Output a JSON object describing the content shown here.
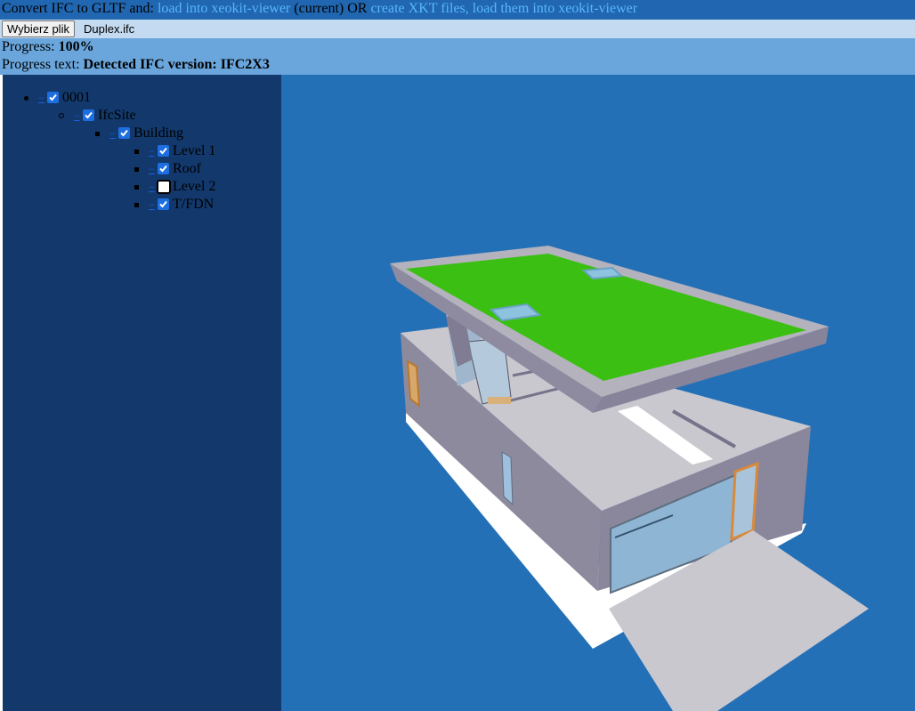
{
  "header": {
    "prefix": "Convert IFC to GLTF and:",
    "link_viewer": "load into xeokit-viewer",
    "current": "(current) OR",
    "link_xkt": "create XKT files, load them into xeokit-viewer"
  },
  "file": {
    "button_label": "Wybierz plik",
    "filename": "Duplex.ifc"
  },
  "progress": {
    "label": "Progress:",
    "value": "100%",
    "text_label": "Progress text:",
    "text_value": "Detected IFC version: IFC2X3"
  },
  "tree": [
    {
      "label": "0001",
      "checked": true,
      "depth": 0
    },
    {
      "label": "IfcSite",
      "checked": true,
      "depth": 1
    },
    {
      "label": "Building",
      "checked": true,
      "depth": 2
    },
    {
      "label": "Level 1",
      "checked": true,
      "depth": 3
    },
    {
      "label": "Roof",
      "checked": true,
      "depth": 3
    },
    {
      "label": "Level 2",
      "checked": false,
      "depth": 3
    },
    {
      "label": "T/FDN",
      "checked": true,
      "depth": 3
    }
  ],
  "toggle_glyph": "−",
  "colors": {
    "viewer_bg": "#2470b7",
    "sidebar_bg": "#12386c",
    "roof_green": "#3bbf12",
    "checkbox_blue": "#1d6ee0"
  }
}
